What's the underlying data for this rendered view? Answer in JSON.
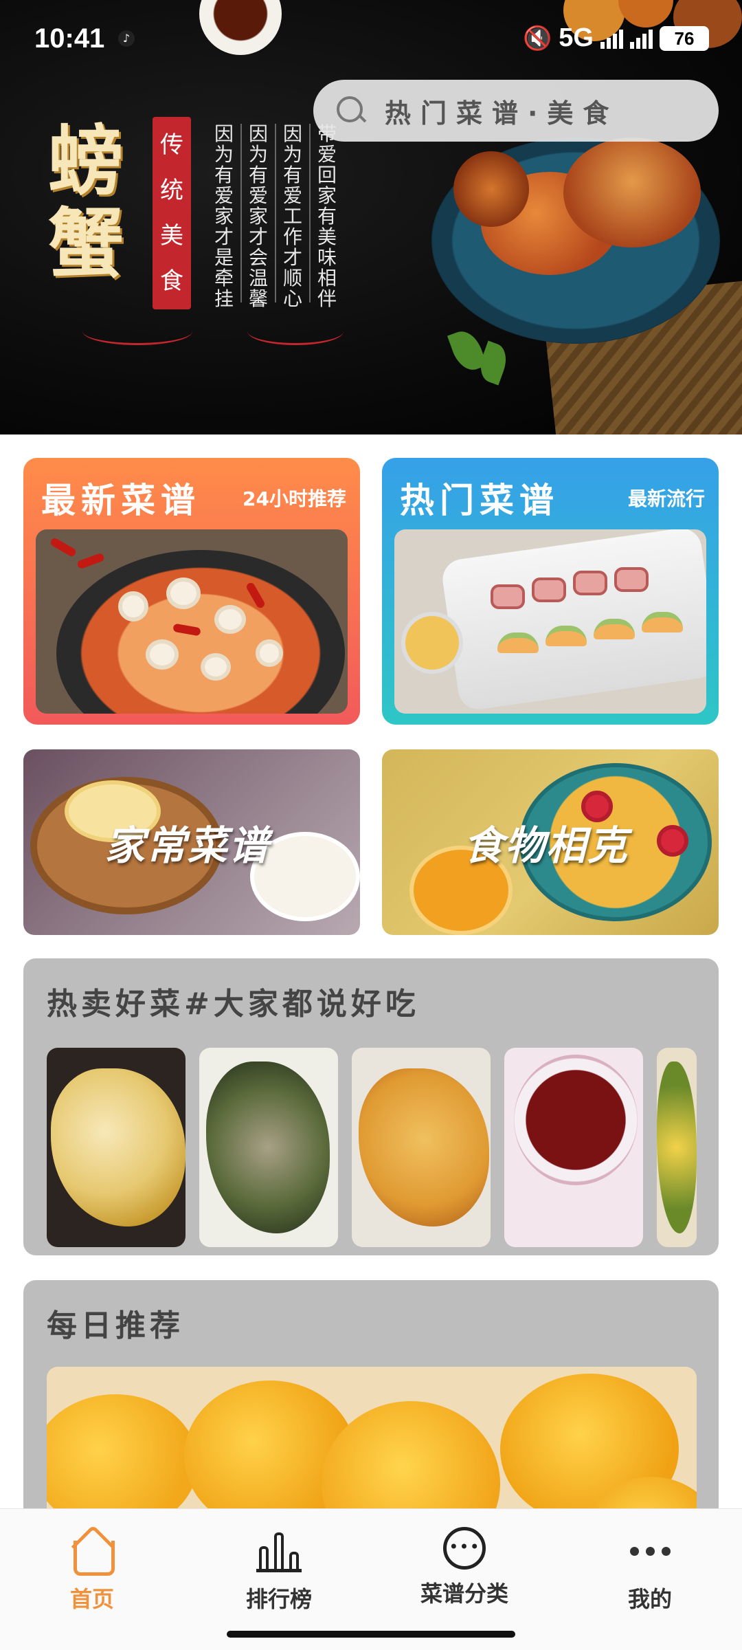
{
  "status_bar": {
    "time": "10:41",
    "network": "5G",
    "battery": "76"
  },
  "banner": {
    "title": [
      "螃",
      "蟹"
    ],
    "seal": [
      "传",
      "统",
      "美",
      "食"
    ],
    "poem_columns": [
      "因为有爱家才是牵挂",
      "因为有爱家才会温馨",
      "因为有爱工作才顺心",
      "带爱回家有美味相伴"
    ]
  },
  "search": {
    "placeholder": "热门菜谱·美食"
  },
  "cards": [
    {
      "title": "最新菜谱",
      "subtitle": "24小时推荐",
      "color_from": "#ff8c4a",
      "color_to": "#f25a5a"
    },
    {
      "title": "热门菜谱",
      "subtitle": "最新流行",
      "color_from": "#36a0e8",
      "color_to": "#2ec6c6"
    }
  ],
  "photo_cards": [
    {
      "label": "家常菜谱"
    },
    {
      "label": "食物相克"
    }
  ],
  "hot_section": {
    "title": "热卖好菜#大家都说好吃"
  },
  "daily_section": {
    "title": "每日推荐"
  },
  "tabs": [
    {
      "label": "首页",
      "icon": "home-icon",
      "active": true
    },
    {
      "label": "排行榜",
      "icon": "bar-chart-icon",
      "active": false
    },
    {
      "label": "菜谱分类",
      "icon": "category-icon",
      "active": false
    },
    {
      "label": "我的",
      "icon": "more-dots-icon",
      "active": false
    }
  ],
  "colors": {
    "accent": "#f0923c",
    "section_bg": "#bdbdbd"
  }
}
